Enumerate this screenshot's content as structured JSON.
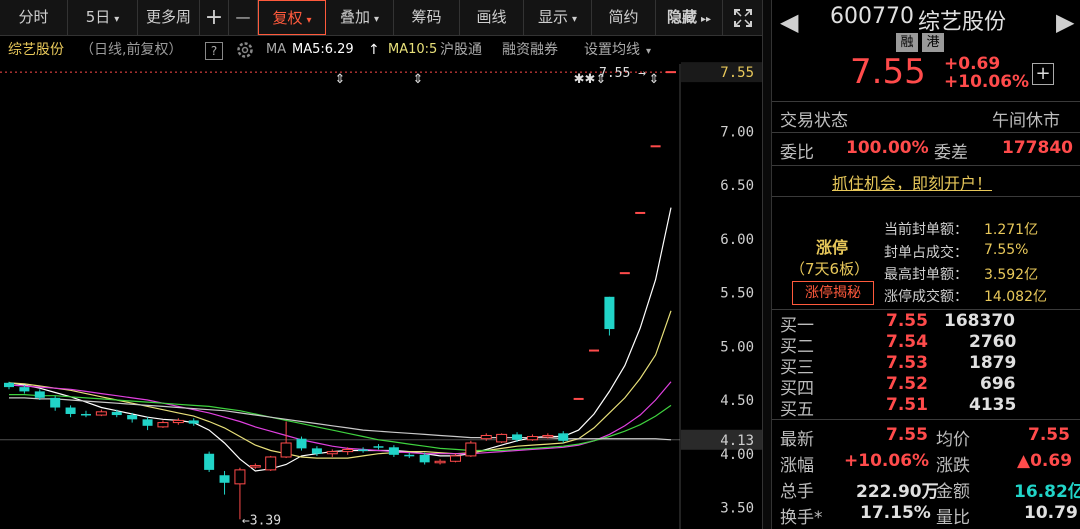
{
  "toolbar": {
    "buttons": [
      {
        "label": "分时",
        "caret": ""
      },
      {
        "label": "5日",
        "caret": "▾"
      },
      {
        "label": "更多周",
        "caret": ""
      },
      {
        "label": "+",
        "caret": ""
      },
      {
        "label": "—",
        "caret": ""
      },
      {
        "label": "复权",
        "caret": "▾"
      },
      {
        "label": "叠加",
        "caret": "▾"
      },
      {
        "label": "筹码",
        "caret": ""
      },
      {
        "label": "画线",
        "caret": ""
      },
      {
        "label": "显示",
        "caret": "▾"
      },
      {
        "label": "简约",
        "caret": ""
      },
      {
        "label": "隐藏",
        "caret": "▸▸"
      }
    ],
    "active_index": 5
  },
  "chart_header": {
    "stock_name": "综艺股份",
    "mode": "（日线,前复权）",
    "help": "?",
    "ma_label": "MA",
    "ma5": "MA5:6.29",
    "ma5_arrow": "↑",
    "ma10": "MA10:5",
    "tabs": [
      "沪股通",
      "融资融券",
      "设置均线"
    ],
    "tab_caret": "▾"
  },
  "chart_data": {
    "type": "candlestick",
    "ylim": [
      3.3,
      7.7
    ],
    "y_ticks": [
      "7.55",
      "7.00",
      "6.50",
      "6.00",
      "5.50",
      "5.00",
      "4.50",
      "4.13",
      "4.00",
      "3.50"
    ],
    "y_tick_values": [
      7.55,
      7.0,
      6.5,
      6.0,
      5.5,
      5.0,
      4.5,
      4.13,
      4.0,
      3.5
    ],
    "current_price_label": "7.55",
    "current_price": 7.55,
    "highlight_price": 4.13,
    "low_annotation": "3.39",
    "low_value": 3.39,
    "high_annotation": "7.55",
    "marker_symbols": [
      "⇕",
      "⇕",
      "✱✱⇕",
      "⇕"
    ],
    "candles": [
      [
        4.66,
        4.62,
        4.67,
        4.6
      ],
      [
        4.62,
        4.58,
        4.64,
        4.56
      ],
      [
        4.58,
        4.52,
        4.6,
        4.5
      ],
      [
        4.52,
        4.43,
        4.54,
        4.4
      ],
      [
        4.43,
        4.37,
        4.45,
        4.34
      ],
      [
        4.37,
        4.36,
        4.4,
        4.34
      ],
      [
        4.36,
        4.39,
        4.41,
        4.35
      ],
      [
        4.39,
        4.36,
        4.41,
        4.34
      ],
      [
        4.36,
        4.32,
        4.38,
        4.29
      ],
      [
        4.32,
        4.26,
        4.34,
        4.22
      ],
      [
        4.25,
        4.29,
        4.31,
        4.24
      ],
      [
        4.29,
        4.31,
        4.33,
        4.27
      ],
      [
        4.31,
        4.28,
        4.33,
        4.26
      ],
      [
        4.0,
        3.85,
        4.02,
        3.83
      ],
      [
        3.8,
        3.73,
        3.84,
        3.62
      ],
      [
        3.72,
        3.85,
        3.87,
        3.39
      ],
      [
        3.88,
        3.89,
        3.91,
        3.86
      ],
      [
        3.85,
        3.97,
        3.98,
        3.84
      ],
      [
        3.97,
        4.1,
        4.3,
        3.96
      ],
      [
        4.14,
        4.05,
        4.16,
        4.03
      ],
      [
        4.05,
        4.0,
        4.07,
        3.98
      ],
      [
        4.0,
        4.02,
        4.04,
        3.97
      ],
      [
        4.02,
        4.04,
        4.06,
        3.99
      ],
      [
        4.04,
        4.03,
        4.06,
        4.01
      ],
      [
        4.07,
        4.06,
        4.09,
        4.04
      ],
      [
        4.06,
        3.99,
        4.08,
        3.97
      ],
      [
        3.99,
        3.98,
        4.01,
        3.96
      ],
      [
        3.99,
        3.92,
        4.01,
        3.9
      ],
      [
        3.92,
        3.93,
        3.95,
        3.9
      ],
      [
        3.93,
        3.98,
        4.0,
        3.92
      ],
      [
        3.98,
        4.1,
        4.12,
        3.97
      ],
      [
        4.14,
        4.17,
        4.19,
        4.12
      ],
      [
        4.11,
        4.18,
        4.19,
        4.1
      ],
      [
        4.18,
        4.13,
        4.2,
        4.11
      ],
      [
        4.13,
        4.16,
        4.18,
        4.12
      ],
      [
        4.16,
        4.17,
        4.19,
        4.14
      ],
      [
        4.19,
        4.12,
        4.21,
        4.1
      ],
      [
        4.51,
        4.51,
        4.51,
        4.51
      ],
      [
        4.96,
        4.96,
        4.96,
        4.96
      ],
      [
        5.46,
        5.16,
        5.46,
        5.1
      ],
      [
        5.68,
        5.68,
        5.68,
        5.68
      ],
      [
        6.24,
        6.24,
        6.24,
        6.24
      ],
      [
        6.86,
        6.86,
        6.86,
        6.86
      ],
      [
        7.55,
        7.55,
        7.55,
        7.55
      ]
    ],
    "ma_series": [
      {
        "color": "#ffffff",
        "values": [
          4.66,
          4.64,
          4.61,
          4.57,
          4.53,
          4.48,
          4.43,
          4.4,
          4.37,
          4.34,
          4.32,
          4.31,
          4.29,
          4.22,
          4.1,
          3.95,
          3.84,
          3.86,
          3.9,
          3.98,
          4.0,
          4.02,
          4.03,
          4.03,
          4.03,
          4.03,
          4.02,
          4.0,
          3.98,
          3.98,
          4.0,
          4.04,
          4.08,
          4.12,
          4.15,
          4.16,
          4.16,
          4.22,
          4.37,
          4.58,
          4.82,
          5.17,
          5.62,
          6.29
        ]
      },
      {
        "color": "#e8e07a",
        "values": [
          4.66,
          4.65,
          4.63,
          4.61,
          4.59,
          4.56,
          4.53,
          4.5,
          4.47,
          4.44,
          4.41,
          4.38,
          4.35,
          4.3,
          4.24,
          4.16,
          4.08,
          4.03,
          4.0,
          3.97,
          3.96,
          3.96,
          3.96,
          3.98,
          4.0,
          4.01,
          4.02,
          4.02,
          4.01,
          4.0,
          4.01,
          4.03,
          4.05,
          4.07,
          4.08,
          4.09,
          4.1,
          4.14,
          4.24,
          4.38,
          4.52,
          4.7,
          4.92,
          5.33
        ]
      },
      {
        "color": "#e040e0",
        "values": [
          4.64,
          4.63,
          4.62,
          4.61,
          4.6,
          4.58,
          4.56,
          4.54,
          4.52,
          4.5,
          4.47,
          4.44,
          4.41,
          4.38,
          4.34,
          4.3,
          4.25,
          4.21,
          4.17,
          4.13,
          4.1,
          4.07,
          4.05,
          4.04,
          4.03,
          4.02,
          4.01,
          4.0,
          4.0,
          4.0,
          4.0,
          4.01,
          4.02,
          4.03,
          4.04,
          4.05,
          4.06,
          4.08,
          4.12,
          4.18,
          4.26,
          4.36,
          4.5,
          4.67
        ]
      },
      {
        "color": "#3fd23f",
        "values": [
          4.55,
          4.55,
          4.54,
          4.54,
          4.53,
          4.52,
          4.51,
          4.5,
          4.49,
          4.48,
          4.47,
          4.46,
          4.45,
          4.44,
          4.42,
          4.4,
          4.37,
          4.34,
          4.31,
          4.28,
          4.25,
          4.22,
          4.19,
          4.16,
          4.13,
          4.11,
          4.09,
          4.07,
          4.05,
          4.04,
          4.03,
          4.03,
          4.03,
          4.04,
          4.05,
          4.06,
          4.07,
          4.09,
          4.12,
          4.16,
          4.21,
          4.27,
          4.35,
          4.45
        ]
      },
      {
        "color": "#c9c9c9",
        "values": [
          4.52,
          4.52,
          4.51,
          4.51,
          4.5,
          4.49,
          4.48,
          4.47,
          4.46,
          4.45,
          4.44,
          4.43,
          4.42,
          4.41,
          4.4,
          4.38,
          4.36,
          4.34,
          4.32,
          4.3,
          4.28,
          4.26,
          4.24,
          4.22,
          4.21,
          4.2,
          4.19,
          4.18,
          4.17,
          4.16,
          4.15,
          4.15,
          4.15,
          4.15,
          4.15,
          4.15,
          4.14,
          4.14,
          4.14,
          4.14,
          4.14,
          4.14,
          4.14,
          4.13
        ]
      }
    ]
  },
  "quote": {
    "code": "600770",
    "name": "综艺股份",
    "badges": [
      "融",
      "港"
    ],
    "price": "7.55",
    "change": "+0.69",
    "change_pct": "+10.06%",
    "plus_icon": "+",
    "trade_status_label": "交易状态",
    "trade_status_value": "午间休市",
    "weibi_label": "委比",
    "weibi_value": "100.00%",
    "weicha_label": "委差",
    "weicha_value": "177840",
    "promo": "抓住机会，即刻开户！"
  },
  "limit_up": {
    "title": "涨停",
    "subtitle": "（7天6板）",
    "reveal_button": "涨停揭秘",
    "rows": [
      {
        "label": "当前封单额：",
        "value": "1.271亿"
      },
      {
        "label": "封单占成交：",
        "value": "7.55%"
      },
      {
        "label": "最高封单额：",
        "value": "3.592亿"
      },
      {
        "label": "涨停成交额：",
        "value": "14.082亿"
      }
    ]
  },
  "bids": [
    {
      "label": "买一",
      "price": "7.55",
      "volume": "168370"
    },
    {
      "label": "买二",
      "price": "7.54",
      "volume": "2760"
    },
    {
      "label": "买三",
      "price": "7.53",
      "volume": "1879"
    },
    {
      "label": "买四",
      "price": "7.52",
      "volume": "696"
    },
    {
      "label": "买五",
      "price": "7.51",
      "volume": "4135"
    }
  ],
  "stats": [
    {
      "l1": "最新",
      "v1": "7.55",
      "l2": "均价",
      "v2": "7.55"
    },
    {
      "l1": "涨幅",
      "v1": "+10.06%",
      "l2": "涨跌",
      "v2": "▲0.69"
    },
    {
      "l1": "总手",
      "v1": "222.90万",
      "l2": "金额",
      "v2": "16.82亿"
    },
    {
      "l1": "换手*",
      "v1": "17.15%",
      "l2": "量比",
      "v2": "10.79"
    }
  ],
  "colors": {
    "up": "#ff4b4b",
    "down": "#21d4c8",
    "bg": "#000000"
  }
}
